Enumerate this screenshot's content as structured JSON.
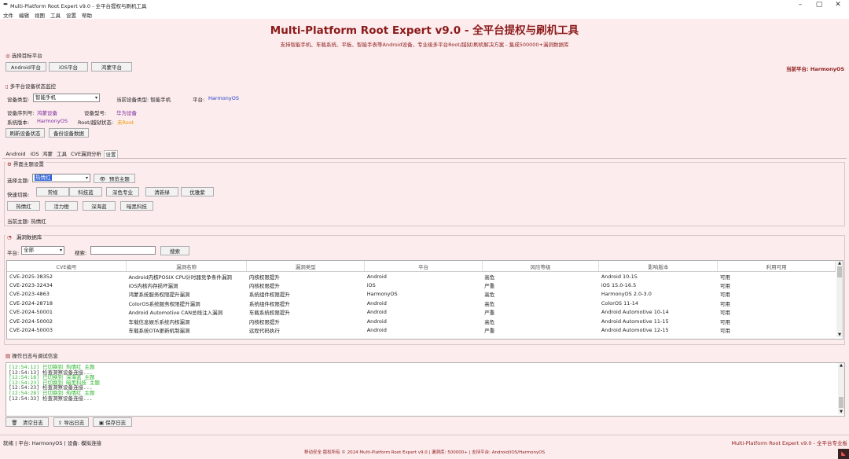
{
  "window": {
    "title": "Multi-Platform Root Expert v9.0 - 全平台提权与刷机工具"
  },
  "menu": [
    "文件",
    "编辑",
    "视图",
    "工具",
    "设置",
    "帮助"
  ],
  "header": {
    "title": "Multi-Platform Root Expert v9.0 - 全平台提权与刷机工具",
    "subtitle": "支持智能手机、车载系统、平板、智能手表等Android设备，专业级多平台Root/越狱/刷机解决方案 - 集成500000+漏洞数据库"
  },
  "target": {
    "title": "选择目标平台",
    "buttons": [
      "Android平台",
      "iOS平台",
      "鸿蒙平台"
    ],
    "current": "当前平台: HarmonyOS"
  },
  "monitor": {
    "title": "多平台设备状态监控",
    "type_label": "设备类型:",
    "type_value": "智能手机",
    "cur_type": "当前设备类型: 智能手机",
    "platform_label": "平台:",
    "platform_value": "HarmonyOS",
    "serial_label": "设备序列号:",
    "serial_value": "鸿蒙设备",
    "model_label": "设备型号:",
    "model_value": "华为设备",
    "sysver_label": "系统版本:",
    "sysver_value": "HarmonyOS",
    "root_label": "Root/越狱状态:",
    "root_value": "未Root",
    "refresh": "刷新设备状态",
    "backup": "备份设备数据"
  },
  "tabs": [
    "Android",
    "iOS",
    "鸿蒙",
    "工具",
    "CVE漏洞分析",
    "设置"
  ],
  "theme": {
    "title": "界面主题设置",
    "select_label": "选择主题:",
    "select_value": "热情红",
    "preview": "预览主题",
    "quick_label": "快速切换:",
    "row1": [
      "常规",
      "科技蓝",
      "深色专业",
      "清新绿",
      "优雅紫"
    ],
    "row2": [
      "热情红",
      "活力橙",
      "深海蓝",
      "暗黑科技"
    ],
    "current": "当前主题: 热情红"
  },
  "vuln": {
    "title": "漏洞数据库",
    "platform_label": "平台:",
    "platform_value": "全部",
    "search_label": "搜索:",
    "search_value": "",
    "search_btn": "搜索",
    "columns": [
      "CVE编号",
      "漏洞名称",
      "漏洞类型",
      "平台",
      "风险等级",
      "影响版本",
      "利用可用"
    ],
    "rows": [
      [
        "CVE-2025-38352",
        "Android内核POSIX CPU计时器竞争条件漏洞",
        "内核权限提升",
        "Android",
        "高危",
        "Android 10-15",
        "可用"
      ],
      [
        "CVE-2023-32434",
        "iOS内核内存损坏漏洞",
        "内核权限提升",
        "iOS",
        "严重",
        "iOS 15.0-16.5",
        "可用"
      ],
      [
        "CVE-2023-4863",
        "鸿蒙系统服务权限提升漏洞",
        "系统组件权限提升",
        "HarmonyOS",
        "高危",
        "HarmonyOS 2.0-3.0",
        "可用"
      ],
      [
        "CVE-2024-28718",
        "ColorOS系统服务权限提升漏洞",
        "系统组件权限提升",
        "Android",
        "高危",
        "ColorOS 11-14",
        "可用"
      ],
      [
        "CVE-2024-50001",
        "Android Automotive CAN总线注入漏洞",
        "车载系统权限提升",
        "Android",
        "严重",
        "Android Automotive 10-14",
        "可用"
      ],
      [
        "CVE-2024-50002",
        "车载信息娱乐系统内核漏洞",
        "内核权限提升",
        "Android",
        "高危",
        "Android Automotive 11-15",
        "可用"
      ],
      [
        "CVE-2024-50003",
        "车载系统OTA更新机制漏洞",
        "远程代码执行",
        "Android",
        "严重",
        "Android Automotive 12-15",
        "可用"
      ]
    ]
  },
  "log": {
    "title": "操作日志与调试信息",
    "lines": [
      {
        "text": "[12:54:12] 已切换到 热情红 主题",
        "color": "#2fb52f"
      },
      {
        "text": "[12:54:13] 检查洞察设备连接...",
        "color": "#333333"
      },
      {
        "text": "[12:54:18] 已切换到 深海蓝 主题",
        "color": "#2fb52f"
      },
      {
        "text": "[12:54:23] 已切换到 暗黑科技 主题",
        "color": "#2fb52f"
      },
      {
        "text": "[12:54:23] 检查洞察设备连接...",
        "color": "#333333"
      },
      {
        "text": "[12:54:28] 已切换到 热情红 主题",
        "color": "#2fb52f"
      },
      {
        "text": "[12:54:33] 检查洞察设备连接...",
        "color": "#333333"
      }
    ],
    "clear": "清空日志",
    "export": "导出日志",
    "save": "保存日志"
  },
  "status": {
    "left": "就绪 | 平台: HarmonyOS | 设备: 模拟连接",
    "right": "Multi-Platform Root Expert v9.0 - 全平台专业板",
    "footer": "移动安全 版权所有 © 2024 Multi-Platform Root Expert v9.0 | 漏洞库: 500000+ | 支持平台: Android/iOS/HarmonyOS"
  },
  "colors": {
    "accent": "#8b1a1a",
    "bg": "#fdeced",
    "blue": "#1a3ec6",
    "orange": "#e69a00",
    "purple": "#7a2aa0"
  }
}
